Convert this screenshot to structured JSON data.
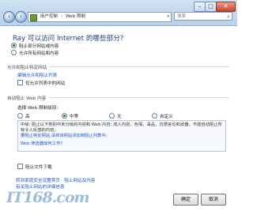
{
  "window": {
    "controls": {
      "minimize": "–",
      "maximize": "□",
      "close": "✕"
    }
  },
  "nav": {
    "back": "‹",
    "forward": "›"
  },
  "breadcrumb": {
    "part1": "用户控制",
    "separator": "›",
    "part2": "Web 限制"
  },
  "search": {
    "placeholder": "搜索"
  },
  "main": {
    "heading": "Ray 可以访问 Internet 的哪些部分?",
    "mode_options": [
      {
        "label": "阻止部分网站或内容",
        "selected": true
      },
      {
        "label": "允许所有网站和内容",
        "selected": false
      }
    ],
    "section_allow_block": {
      "title": "允许和阻止特定网站",
      "edit_link": "编辑允许和阻止列表",
      "only_allowed_label": "仅允许列表中的网站"
    },
    "section_web_limit": {
      "title": "自动阻止 Web 内容",
      "choose_label": "选择 Web 限制级别:",
      "levels": [
        {
          "label": "高",
          "selected": false
        },
        {
          "label": "中等",
          "selected": true
        },
        {
          "label": "无",
          "selected": false
        },
        {
          "label": "自定义",
          "selected": false
        }
      ],
      "description": "中级: 阻止以下类别中未分级的内容和 Web 内容: 成人内容、色情、毒品、仇恨言论和武器。不能自动阻止所有令人反感的内容。",
      "description_line2": "要阻止特定网站,请将该网站添加到阻止列表中。",
      "link_more": "Web 筛选器如何工作?"
    },
    "block_download_label": "阻止文件下载",
    "bottom_link1": "转到家庭安全设置首页 · 阻止网站及内容",
    "bottom_link2": "有关阻止网站的详细信息"
  },
  "buttons": {
    "ok": "确定",
    "cancel": "取消"
  },
  "watermark": "IT168.com"
}
